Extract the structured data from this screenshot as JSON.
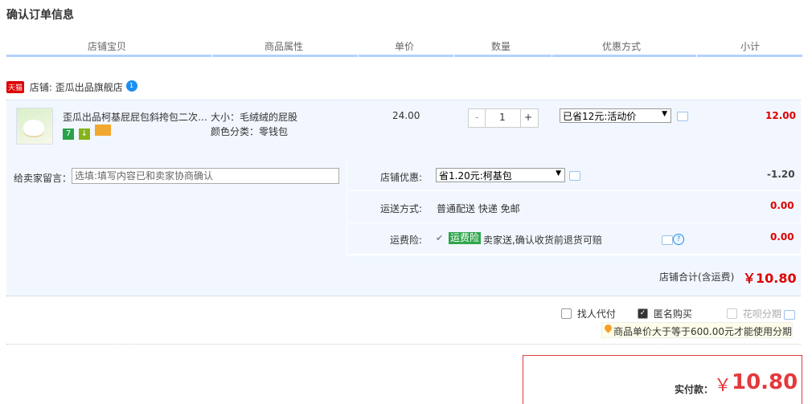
{
  "page": {
    "title": "确认订单信息"
  },
  "columns": [
    "店铺宝贝",
    "商品属性",
    "单价",
    "数量",
    "优惠方式",
    "小计"
  ],
  "shop": {
    "badge": "天猫",
    "label": "店铺: 歪瓜出品旗舰店",
    "wang_badge": "1"
  },
  "item": {
    "name": "歪瓜出品柯基屁屁包斜挎包二次…",
    "attr_size": "大小：毛绒绒的屁股",
    "attr_color": "颜色分类：零钱包",
    "price": "24.00",
    "qty_minus": "-",
    "qty_value": "1",
    "qty_plus": "+",
    "discount_select": "已省12元:活动价",
    "subtotal": "12.00",
    "tags": [
      "7",
      "↓",
      ""
    ]
  },
  "message": {
    "label": "给卖家留言：",
    "placeholder": "选填:填写内容已和卖家协商确认"
  },
  "shop_discount": {
    "label": "店铺优惠:",
    "select": "省1.20元:柯基包",
    "value": "-1.20"
  },
  "shipping": {
    "label": "运送方式:",
    "value": "普通配送 快递 免邮",
    "amount": "0.00"
  },
  "insurance": {
    "label": "运费险:",
    "badge": "运费险",
    "text": "卖家送,确认收货前退货可赔",
    "amount": "0.00",
    "help": "?"
  },
  "shop_total": {
    "label": "店铺合计(含运费)",
    "value": "￥10.80"
  },
  "options": [
    {
      "label": "找人代付",
      "checked": false
    },
    {
      "label": "匿名购买",
      "checked": true
    },
    {
      "label": "花呗分期",
      "checked": false
    }
  ],
  "installment_tip": "商品单价大于等于600.00元才能使用分期",
  "payment": {
    "label": "实付款：",
    "currency": "￥",
    "amount": "10.80"
  },
  "colors": {
    "accent_red": "#e4393c",
    "header_line": "#b2d1ff",
    "row_bg": "#f2f7ff"
  }
}
